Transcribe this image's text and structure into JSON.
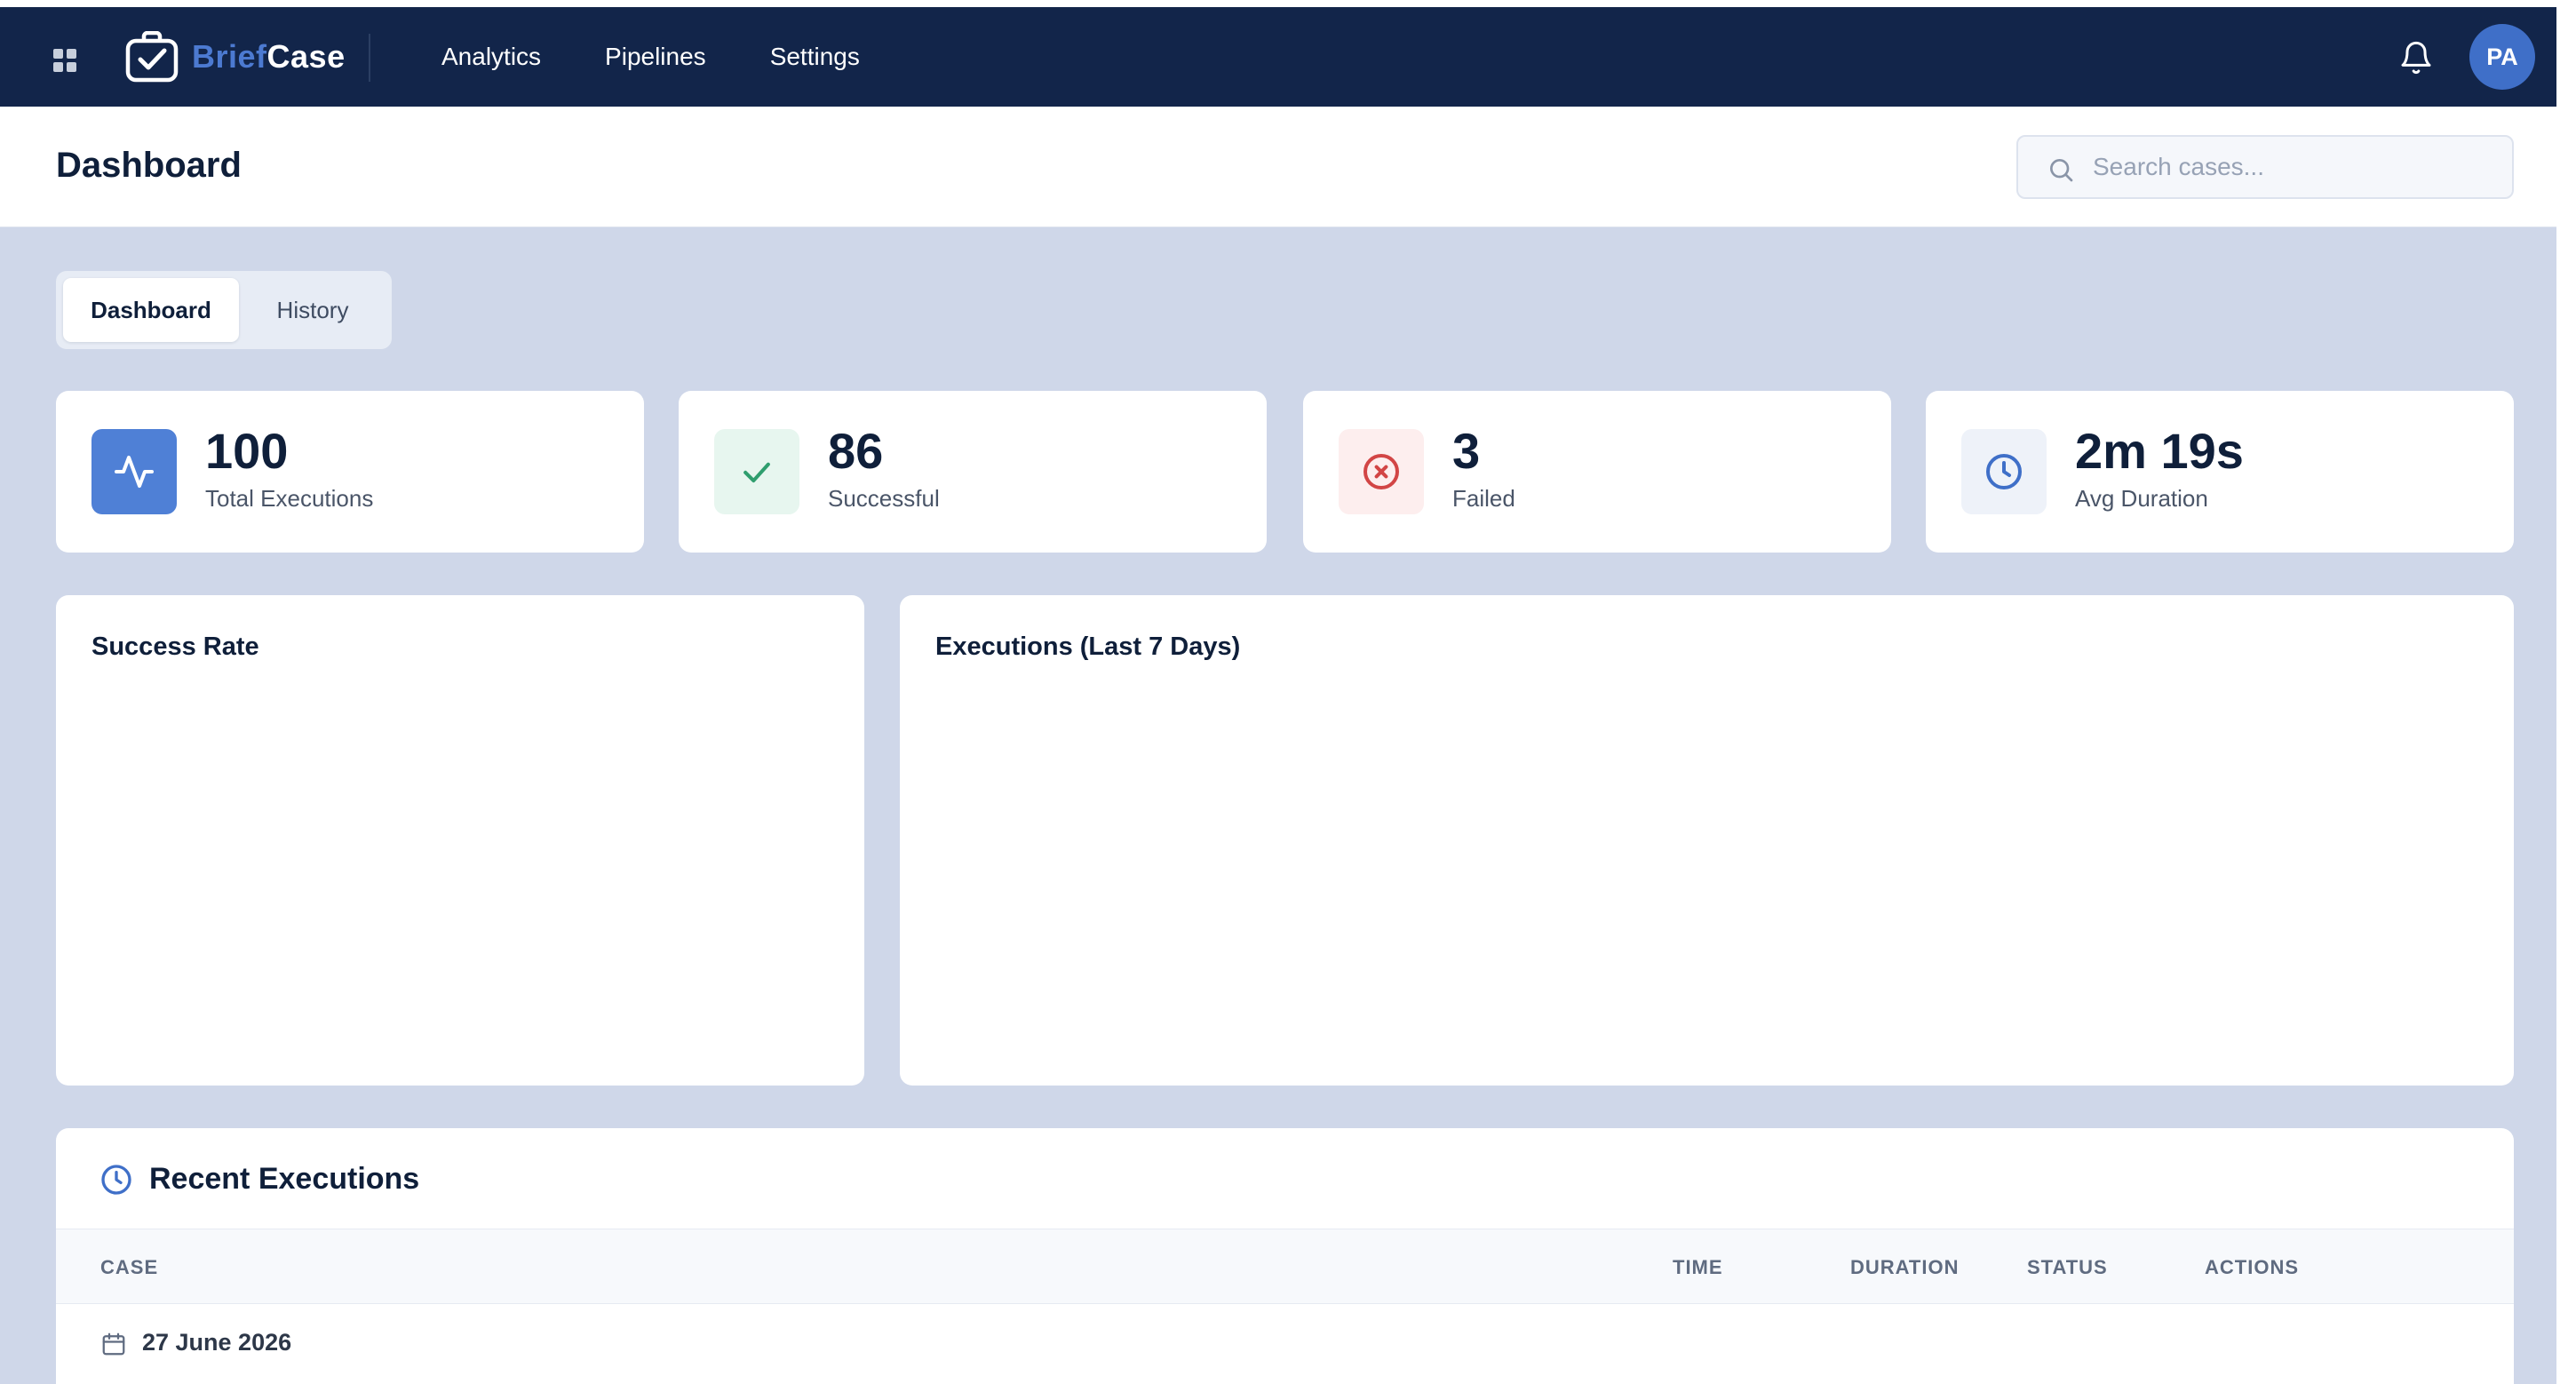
{
  "brand": {
    "part1": "Brief",
    "part2": "Case"
  },
  "nav": {
    "items": [
      "Analytics",
      "Pipelines",
      "Settings"
    ]
  },
  "user": {
    "initials": "PA"
  },
  "header": {
    "title": "Dashboard",
    "search_placeholder": "Search cases..."
  },
  "tabs": {
    "items": [
      {
        "label": "Dashboard",
        "active": true
      },
      {
        "label": "History",
        "active": false
      }
    ]
  },
  "stats": [
    {
      "value": "100",
      "label": "Total Executions",
      "icon": "activity-icon"
    },
    {
      "value": "86",
      "label": "Successful",
      "icon": "check-icon"
    },
    {
      "value": "3",
      "label": "Failed",
      "icon": "x-circle-icon"
    },
    {
      "value": "2m 19s",
      "label": "Avg Duration",
      "icon": "clock-icon"
    }
  ],
  "panels": {
    "success_rate_title": "Success Rate",
    "executions_title": "Executions (Last 7 Days)"
  },
  "recent": {
    "title": "Recent Executions",
    "columns": [
      "CASE",
      "TIME",
      "DURATION",
      "STATUS",
      "ACTIONS"
    ],
    "groups": [
      {
        "date": "27 June 2026"
      }
    ]
  },
  "colors": {
    "nav_bg": "#12254a",
    "accent": "#4c7ad1",
    "page_bg": "#cfd7e9",
    "success": "#2f9e6e",
    "danger": "#d24545"
  }
}
